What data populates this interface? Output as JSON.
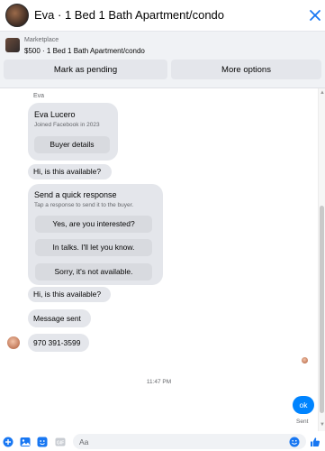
{
  "header": {
    "title": "Eva · 1 Bed 1 Bath Apartment/condo"
  },
  "marketplace": {
    "label": "Marketplace",
    "listing": "$500 · 1 Bed 1 Bath Apartment/condo",
    "mark_pending_label": "Mark as pending",
    "more_options_label": "More options"
  },
  "conversation": {
    "sender_name": "Eva",
    "profile": {
      "name": "Eva Lucero",
      "joined": "Joined Facebook in 2023",
      "buyer_details_label": "Buyer details"
    },
    "message1": "Hi, is this available?",
    "quick_response": {
      "title": "Send a quick response",
      "subtitle": "Tap a response to send it to the buyer.",
      "options": [
        "Yes, are you interested?",
        "In talks. I'll let you know.",
        "Sorry, it's not available."
      ]
    },
    "message2": "Hi, is this available?",
    "message_sent": "Message sent",
    "phone": "970 391-3599",
    "timestamp": "11:47 PM",
    "my_message": "ok",
    "sent_status": "Sent"
  },
  "composer": {
    "placeholder": "Aa"
  },
  "colors": {
    "accent": "#0084ff",
    "bubble_gray": "#e4e6eb"
  },
  "icons": {
    "close": "close-icon",
    "add": "plus-circle-icon",
    "gallery": "image-icon",
    "sticker": "sticker-icon",
    "gif": "gif-icon",
    "emoji": "emoji-icon",
    "like": "thumbs-up-icon"
  }
}
